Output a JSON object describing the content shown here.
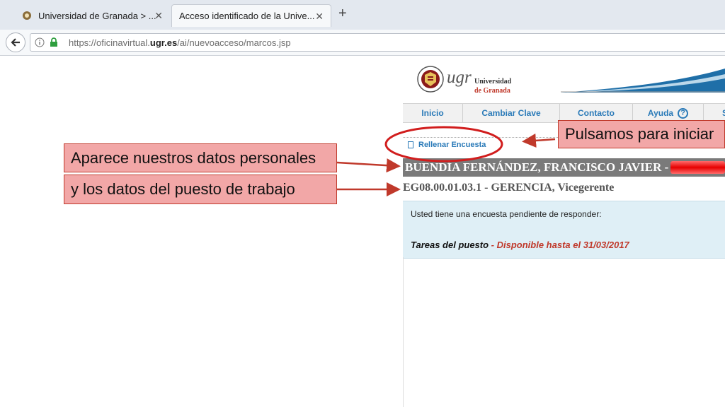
{
  "browser": {
    "tabs": [
      {
        "title": "Universidad de Granada > ...",
        "active": false
      },
      {
        "title": "Acceso identificado de la Unive...",
        "active": true
      }
    ],
    "url": {
      "prefix": "https://oficinavirtual.",
      "domain": "ugr.es",
      "path": "/ai/nuevoacceso/marcos.jsp"
    }
  },
  "header": {
    "logo_text": "ugr",
    "university_line1": "Universidad",
    "university_line2": "de Granada"
  },
  "menu": {
    "items": [
      "Inicio",
      "Cambiar Clave",
      "Contacto",
      "Ayuda",
      "S"
    ]
  },
  "survey_link": "Rellenar Encuesta",
  "person": {
    "name": "BUENDÍA FERNÁNDEZ, FRANCISCO JAVIER -",
    "job": "EG08.00.01.03.1 - GERENCIA, Vicegerente"
  },
  "survey": {
    "pending_text": "Usted tiene una encuesta pendiente de responder:",
    "task_name": "Tareas del puesto",
    "separator": " - ",
    "availability": "Disponible hasta el 31/03/2017"
  },
  "annotations": {
    "personal": "Aparece nuestros datos personales",
    "job": "y los datos del puesto de trabajo",
    "start": "Pulsamos para iniciar"
  },
  "colors": {
    "link_blue": "#2a7ab8",
    "annotation_fill": "#f2a7a7",
    "annotation_red": "#c0392b",
    "name_bar": "#7a7a7a",
    "survey_bg": "#dfeff6"
  }
}
